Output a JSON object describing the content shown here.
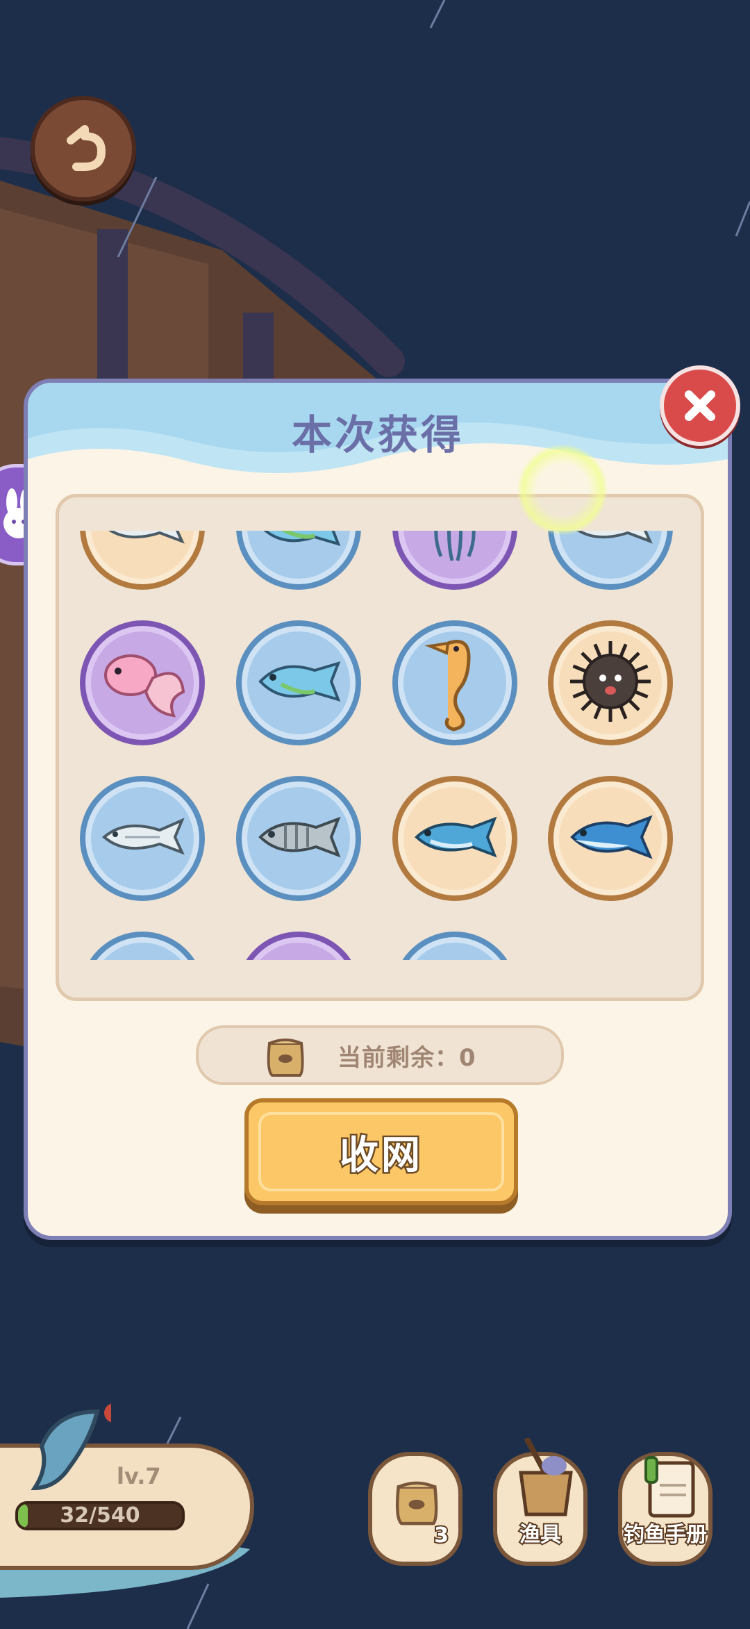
{
  "dialog": {
    "title": "本次获得",
    "remaining_label": "当前剩余：0",
    "collect_button": "收网"
  },
  "catch_items": [
    {
      "rarity": "orange",
      "fish": "silver-fish"
    },
    {
      "rarity": "blue",
      "fish": "blue-green-fish"
    },
    {
      "rarity": "purple",
      "fish": "jellyfish"
    },
    {
      "rarity": "blue",
      "fish": "silver-fish"
    },
    {
      "rarity": "purple",
      "fish": "goldfish"
    },
    {
      "rarity": "blue",
      "fish": "blue-green-fish"
    },
    {
      "rarity": "blue",
      "fish": "seahorse"
    },
    {
      "rarity": "orange",
      "fish": "sea-urchin"
    },
    {
      "rarity": "blue",
      "fish": "silver-fish"
    },
    {
      "rarity": "blue",
      "fish": "grey-striped-fish"
    },
    {
      "rarity": "orange",
      "fish": "blue-mackerel"
    },
    {
      "rarity": "orange",
      "fish": "bluefin-fish"
    },
    {
      "rarity": "blue",
      "fish": "partial"
    },
    {
      "rarity": "purple",
      "fish": "partial"
    },
    {
      "rarity": "blue",
      "fish": "partial"
    }
  ],
  "player": {
    "level": "lv.7",
    "xp": "32/540",
    "xp_fraction": 0.06
  },
  "hud": {
    "bait_count": "3",
    "gear_label": "渔具",
    "handbook_label": "钓鱼手册"
  },
  "colors": {
    "dialog_border": "#7d7fb5",
    "title": "#6b6fa8",
    "button": "#fcc766",
    "close": "#d94a4a"
  }
}
